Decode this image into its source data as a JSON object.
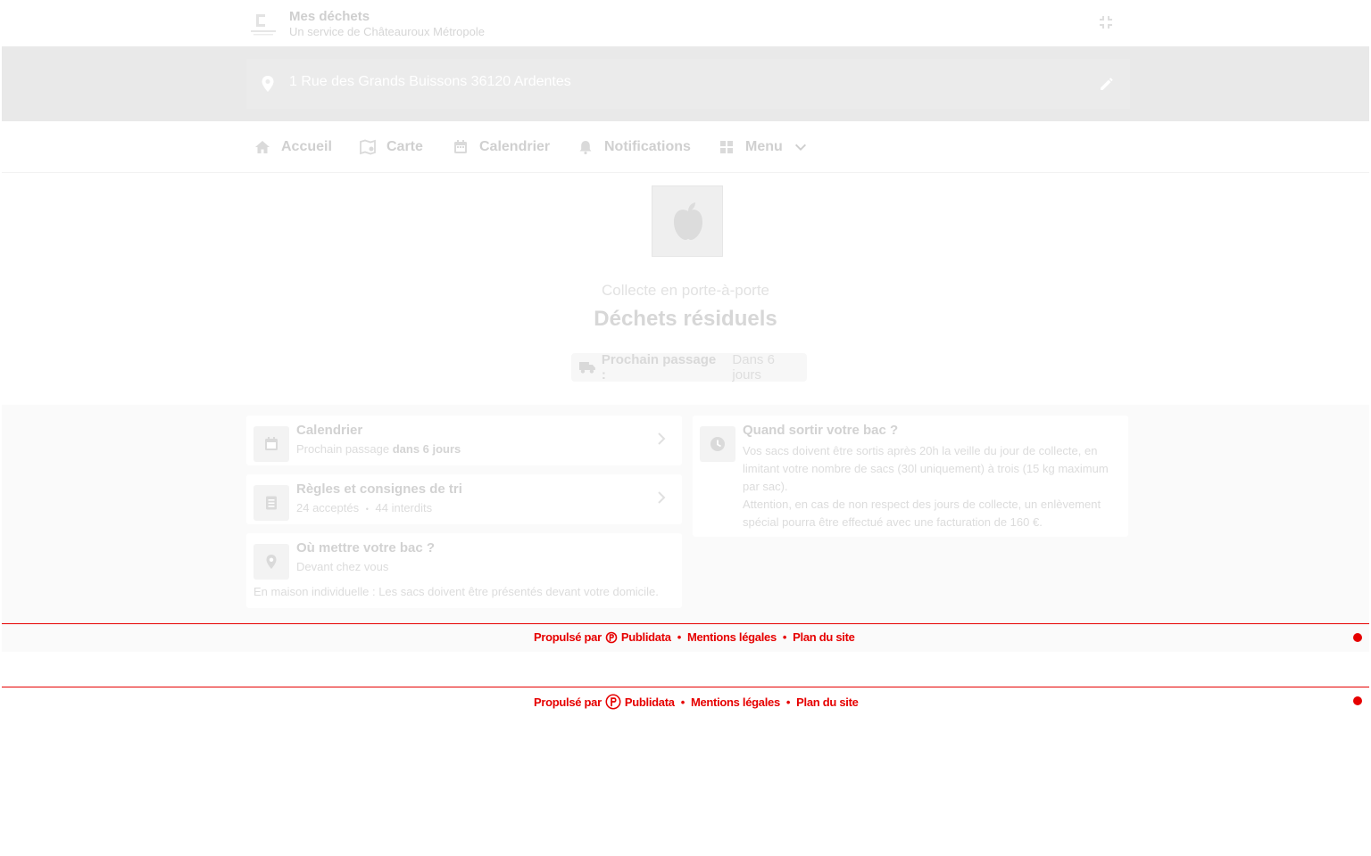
{
  "header": {
    "title": "Mes déchets",
    "subtitle": "Un service de Châteauroux Métropole"
  },
  "address": {
    "text": "1 Rue des Grands Buissons 36120 Ardentes"
  },
  "nav": {
    "items": [
      {
        "label": "Accueil",
        "icon": "home-icon"
      },
      {
        "label": "Carte",
        "icon": "map-icon"
      },
      {
        "label": "Calendrier",
        "icon": "calendar-icon"
      },
      {
        "label": "Notifications",
        "icon": "bell-icon"
      },
      {
        "label": "Menu",
        "icon": "grid-icon"
      }
    ]
  },
  "hero": {
    "subtitle": "Collecte en porte-à-porte",
    "title": "Déchets résiduels",
    "next_label": "Prochain passage :",
    "next_value": "Dans 6 jours"
  },
  "cards": {
    "calendar": {
      "title": "Calendrier",
      "line_prefix": "Prochain passage",
      "line_bold": "dans 6 jours"
    },
    "rules": {
      "title": "Règles et consignes de tri",
      "accepted": "24 acceptés",
      "separator": "•",
      "forbidden": "44 interdits"
    },
    "where": {
      "title": "Où mettre votre bac ?",
      "line": "Devant chez vous",
      "note": "En maison individuelle : Les sacs doivent être présentés devant votre domicile."
    },
    "when": {
      "title": "Quand sortir votre bac ?",
      "para1": "Vos sacs doivent être sortis après 20h la veille du jour de collecte, en limitant votre nombre de sacs (30l uniquement) à trois (15 kg maximum par sac).",
      "para2": "Attention, en cas de non respect des jours de collecte, un enlèvement spécial pourra être effectué avec une facturation de 160 €."
    }
  },
  "footer": {
    "powered": "Propulsé par",
    "brand": "Publidata",
    "sep": "•",
    "legal": "Mentions légales",
    "sitemap": "Plan du site"
  },
  "colors": {
    "accent": "#e60000",
    "address_bg": "#e9e9e9",
    "content_bg": "#fafafa"
  }
}
